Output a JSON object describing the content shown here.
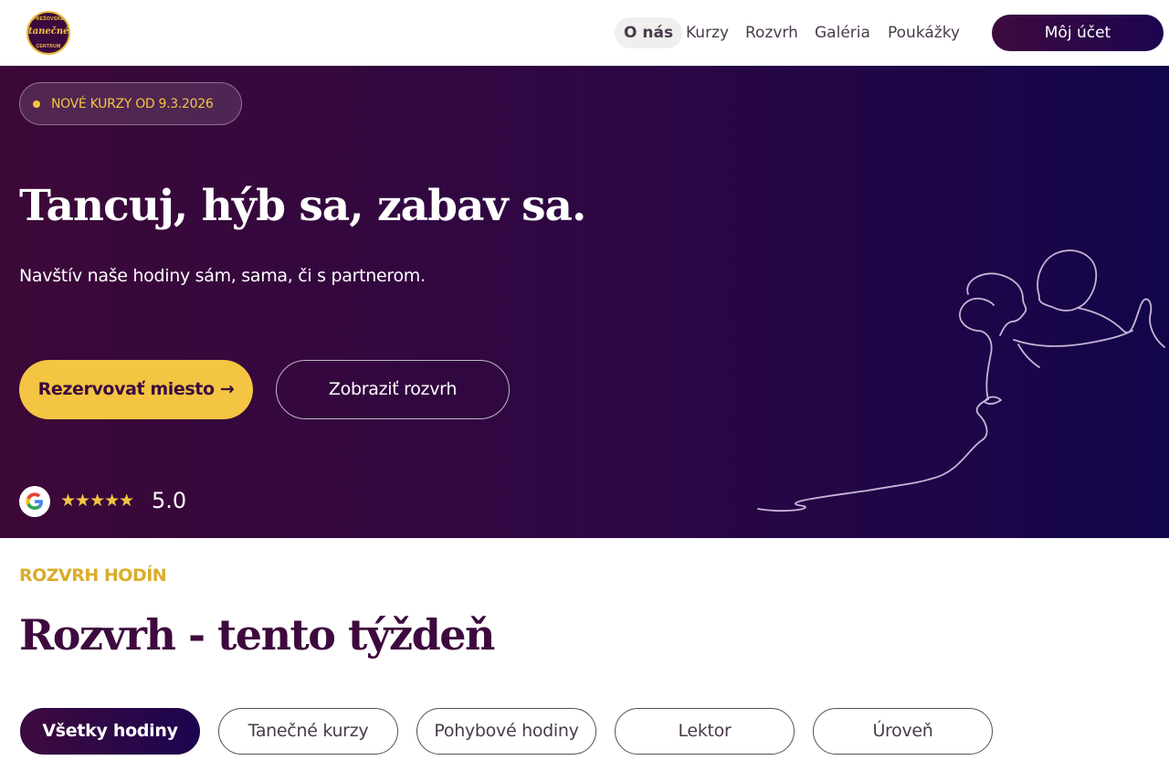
{
  "header": {
    "logo": {
      "top_text": "PREŠOVSKÉ",
      "main_text": "tanečné",
      "bottom_text": "CENTRUM"
    },
    "nav": [
      {
        "label": "O nás",
        "active": true
      },
      {
        "label": "Kurzy",
        "active": false
      },
      {
        "label": "Rozvrh",
        "active": false
      },
      {
        "label": "Galéria",
        "active": false
      },
      {
        "label": "Poukážky",
        "active": false
      }
    ],
    "account_label": "Môj účet"
  },
  "hero": {
    "badge": "NOVÉ KURZY OD 9.3.2026",
    "title": "Tancuj, hýb sa, zabav sa.",
    "subtitle": "Navštív naše hodiny sám, sama, či s partnerom.",
    "primary_button": "Rezervovať miesto →",
    "secondary_button": "Zobraziť rozvrh",
    "google_letter": "G",
    "stars": "★★★★★",
    "rating_value": 5.0,
    "rating": "5.0"
  },
  "schedule": {
    "eyebrow": "ROZVRH HODÍN",
    "title": "Rozvrh - tento týždeň",
    "filters": [
      {
        "label": "Všetky hodiny",
        "active": true
      },
      {
        "label": "Tanečné kurzy",
        "active": false
      },
      {
        "label": "Pohybové hodiny",
        "active": false
      },
      {
        "label": "Lektor",
        "active": false
      },
      {
        "label": "Úroveň",
        "active": false
      }
    ]
  },
  "colors": {
    "brand_dark": "#3e0a3e",
    "brand_navy": "#1c0550",
    "accent_yellow": "#f4c542",
    "eyebrow_gold": "#d9ad2a"
  }
}
